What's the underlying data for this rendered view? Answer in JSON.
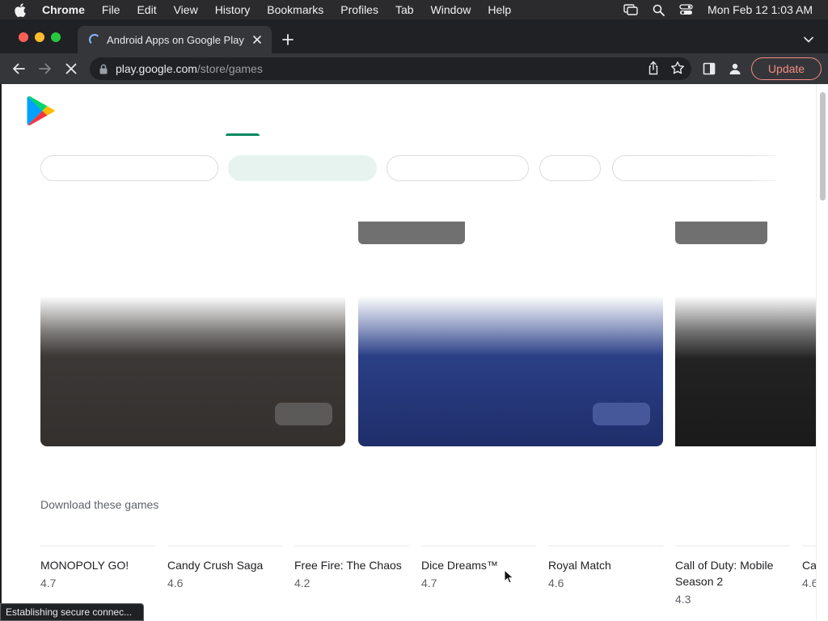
{
  "menubar": {
    "app": "Chrome",
    "items": [
      "File",
      "Edit",
      "View",
      "History",
      "Bookmarks",
      "Profiles",
      "Tab",
      "Window",
      "Help"
    ],
    "clock": "Mon Feb 12  1:03 AM",
    "icons": [
      "apple-icon",
      "screen-mirroring-icon",
      "spotlight-search-icon",
      "control-center-icon"
    ]
  },
  "browser": {
    "tab_title": "Android Apps on Google Play",
    "url_host": "play.google.com",
    "url_path": "/store/games",
    "update_label": "Update",
    "status_text": "Establishing secure connec..."
  },
  "page": {
    "section_title": "Download these games",
    "games": [
      {
        "name": "MONOPOLY GO!",
        "rating": "4.7"
      },
      {
        "name": "Candy Crush Saga",
        "rating": "4.6"
      },
      {
        "name": "Free Fire: The Chaos",
        "rating": "4.2"
      },
      {
        "name": "Dice Dreams™",
        "rating": "4.7"
      },
      {
        "name": "Royal Match",
        "rating": "4.6"
      },
      {
        "name": "Call of Duty: Mobile Season 2",
        "rating": "4.3"
      },
      {
        "name": "Ca Sa",
        "rating": "4.6"
      }
    ]
  },
  "colors": {
    "play_green": "#01875f",
    "chip_active": "#e6f3ef",
    "card_dark": "#33302e",
    "card_blue": "#1f2e6a",
    "update_red": "#f28b82"
  }
}
